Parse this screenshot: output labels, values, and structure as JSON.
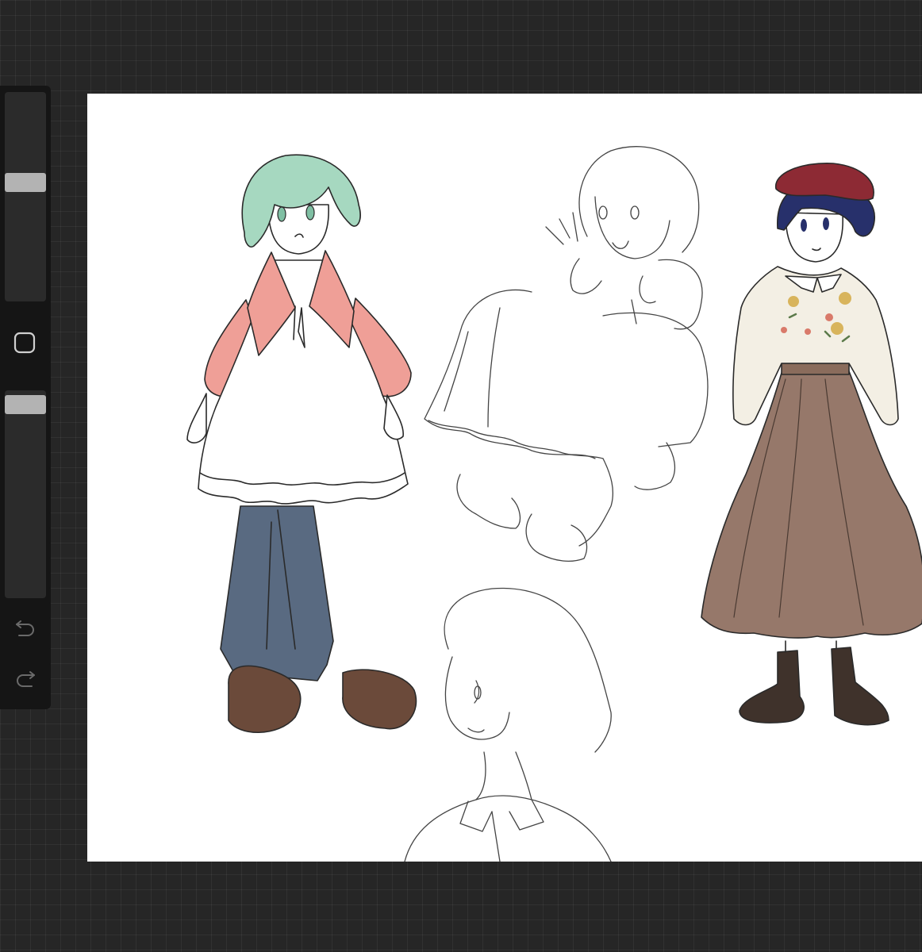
{
  "app": {
    "name": "drawing-app",
    "accent": "#b3b3b3",
    "background": "#262626",
    "sidebar_background": "#151515",
    "canvas_background": "#ffffff"
  },
  "sidebar": {
    "brush_size_slider": {
      "level": 0.9
    },
    "modify_button": {
      "icon": "square-outline-icon"
    },
    "opacity_slider": {
      "level": 1.0
    },
    "undo": {
      "icon": "undo-icon"
    },
    "redo": {
      "icon": "redo-icon"
    }
  },
  "canvas": {
    "content": "character-sketches",
    "colors": {
      "hair_green": "#a6d8c0",
      "cardigan_pink": "#ef9f97",
      "jeans_blue": "#596a81",
      "shoes_brown": "#6b4a3a",
      "beret_red": "#8d2a34",
      "hair_navy": "#27306b",
      "skirt_brown": "#96786a",
      "boots_dark": "#3f322b",
      "blouse_cream": "#f3efe4"
    }
  }
}
